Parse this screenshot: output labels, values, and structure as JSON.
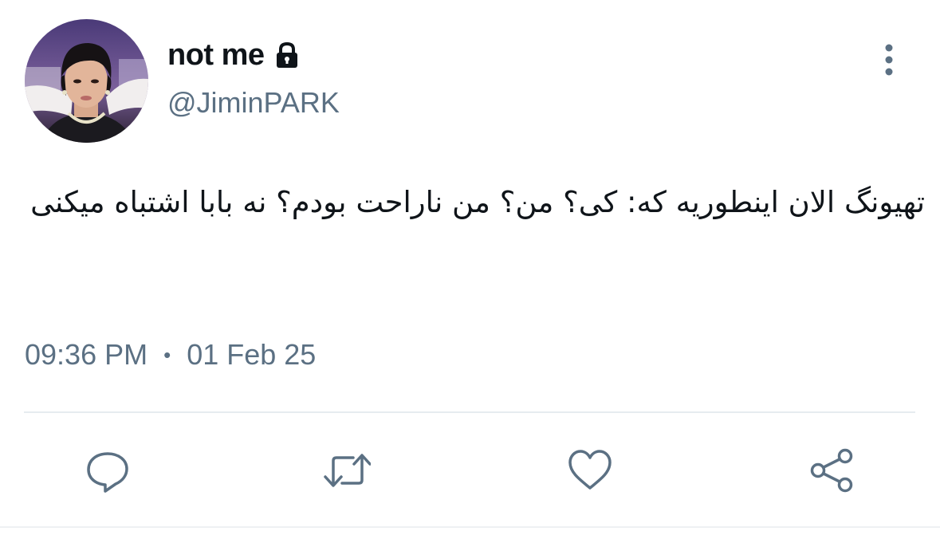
{
  "user": {
    "display_name": "not me",
    "handle": "@JiminPARK",
    "protected_icon": "lock-icon",
    "avatar_icon": "profile-photo"
  },
  "tweet": {
    "text": "تهیونگ الان اینطوریه که: کی؟ من؟ من ناراحت بودم؟ نه بابا اشتباه میکنی",
    "time": "09:36 PM",
    "separator": "•",
    "date": "01 Feb 25"
  },
  "actions": [
    {
      "icon": "reply-icon"
    },
    {
      "icon": "retweet-icon"
    },
    {
      "icon": "like-icon"
    },
    {
      "icon": "share-icon"
    }
  ],
  "menu_icon": "more-vertical-icon",
  "colors": {
    "text_primary": "#0f1419",
    "text_secondary": "#5b7083",
    "divider": "#e6ecf0",
    "icon": "#5b7083"
  }
}
